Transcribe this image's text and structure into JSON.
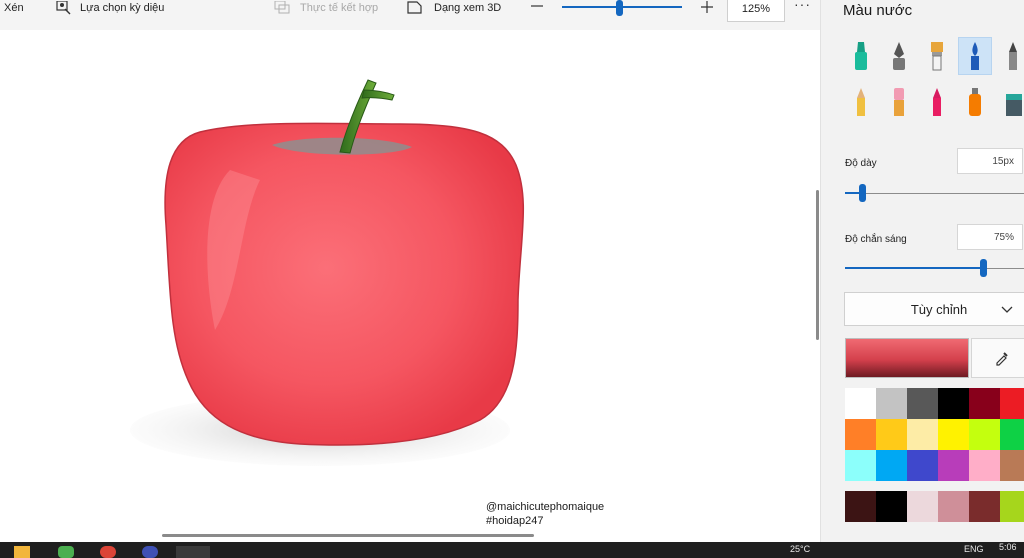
{
  "toolbar": {
    "crop_label": "Xén",
    "magic_select_label": "Lựa chọn kỳ diệu",
    "mixed_reality_label": "Thực tế kết hợp",
    "view_3d_label": "Dạng xem 3D",
    "zoom_level": "125%",
    "zoom_slider_fraction": 0.45,
    "more_label": "···"
  },
  "canvas": {
    "credit_line_1": "@maichicutephomaique",
    "credit_line_2": "#hoidap247"
  },
  "panel": {
    "title": "Màu nước",
    "brushes": [
      "marker-icon",
      "calligraphy-pen-icon",
      "oil-brush-icon",
      "watercolor-icon",
      "pixel-pen-icon",
      "pencil-icon",
      "eraser-icon",
      "crayon-icon",
      "spray-can-icon",
      "fill-bucket-icon"
    ],
    "selected_brush": "watercolor-icon",
    "thickness_label": "Độ dày",
    "thickness_value": "15px",
    "thickness_fraction": 0.08,
    "opacity_label": "Độ chắn sáng",
    "opacity_value": "75%",
    "opacity_fraction": 0.75,
    "custom_label": "Tùy chỉnh",
    "current_color": "#e64552",
    "palette": [
      [
        "#ffffff",
        "#c3c3c3",
        "#585858",
        "#000000",
        "#88001b",
        "#ec1c24"
      ],
      [
        "#ff7f27",
        "#ffca18",
        "#fdeca6",
        "#fff200",
        "#c4ff0e",
        "#0ed145"
      ],
      [
        "#8cfffb",
        "#00a8f3",
        "#3f48cc",
        "#b83dba",
        "#ffaec8",
        "#b97a56"
      ]
    ],
    "custom_colors": [
      "#3c1414",
      "#000000",
      "#ecd8dc",
      "#cf8f99",
      "#7a2c2c",
      "#a6d61c"
    ]
  },
  "taskbar": {
    "weather": "25°C",
    "lang": "ENG",
    "time": "5:06"
  }
}
